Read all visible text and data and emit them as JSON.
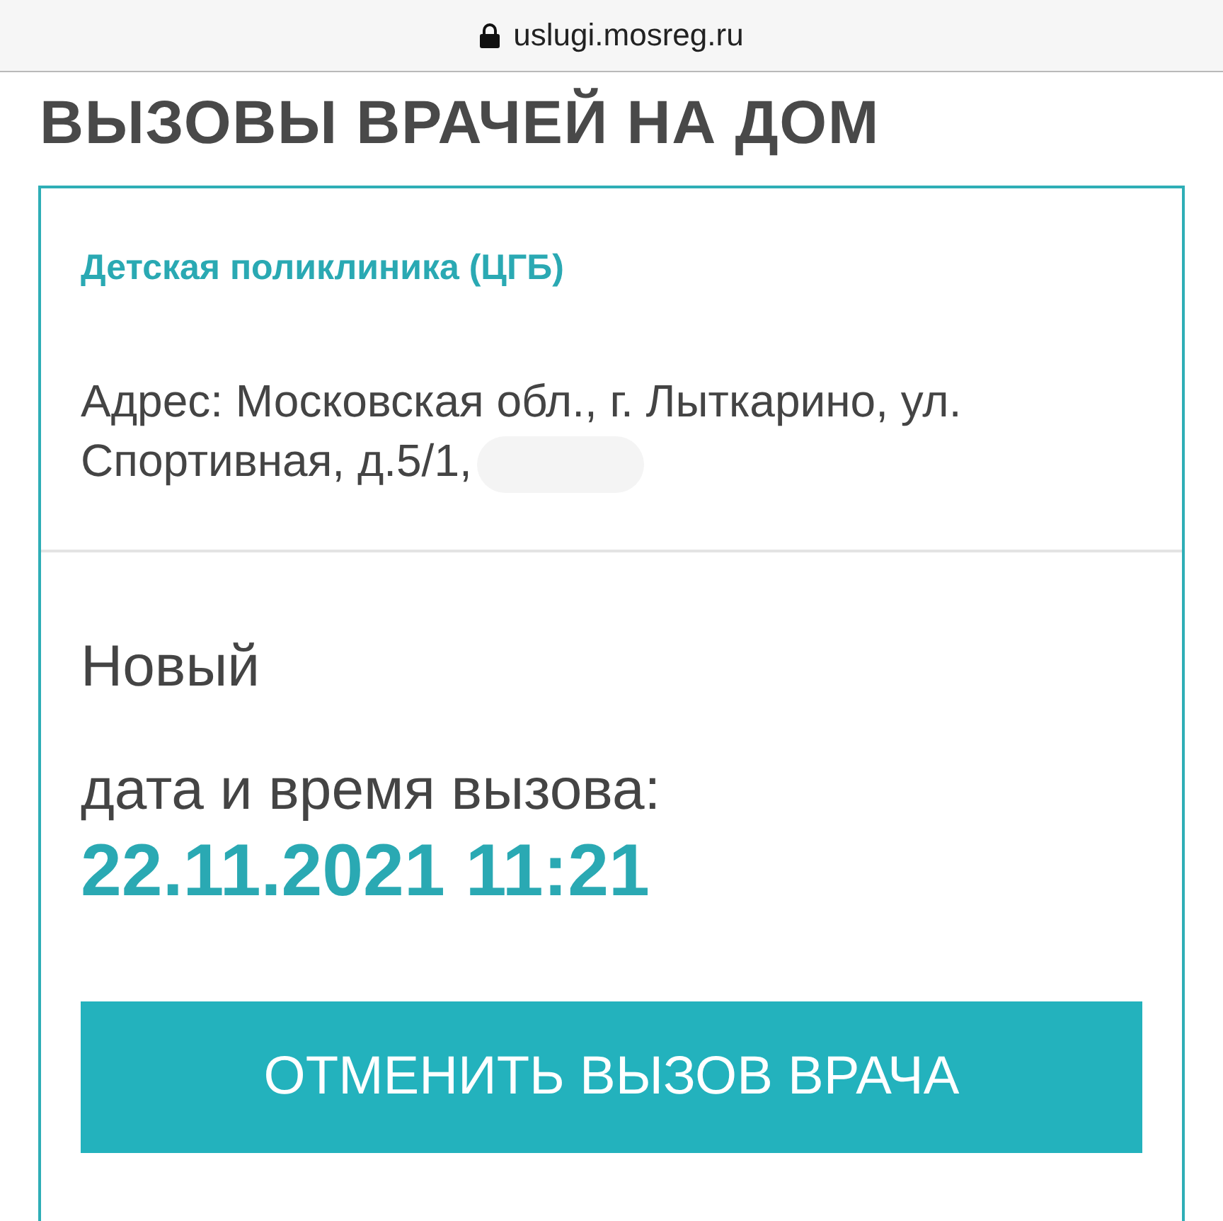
{
  "browser": {
    "url": "uslugi.mosreg.ru",
    "secure": true
  },
  "page": {
    "title": "ВЫЗОВЫ ВРАЧЕЙ НА ДОМ"
  },
  "call": {
    "clinic": "Детская поликлиника (ЦГБ)",
    "address": "Адрес: Московская обл., г. Лыткарино, ул. Спортивная, д.5/1,",
    "address_redacted": true,
    "status": "Новый",
    "datetime_label": "дата и время вызова:",
    "datetime": "22.11.2021 11:21",
    "cancel_button": "ОТМЕНИТЬ ВЫЗОВ ВРАЧА"
  }
}
